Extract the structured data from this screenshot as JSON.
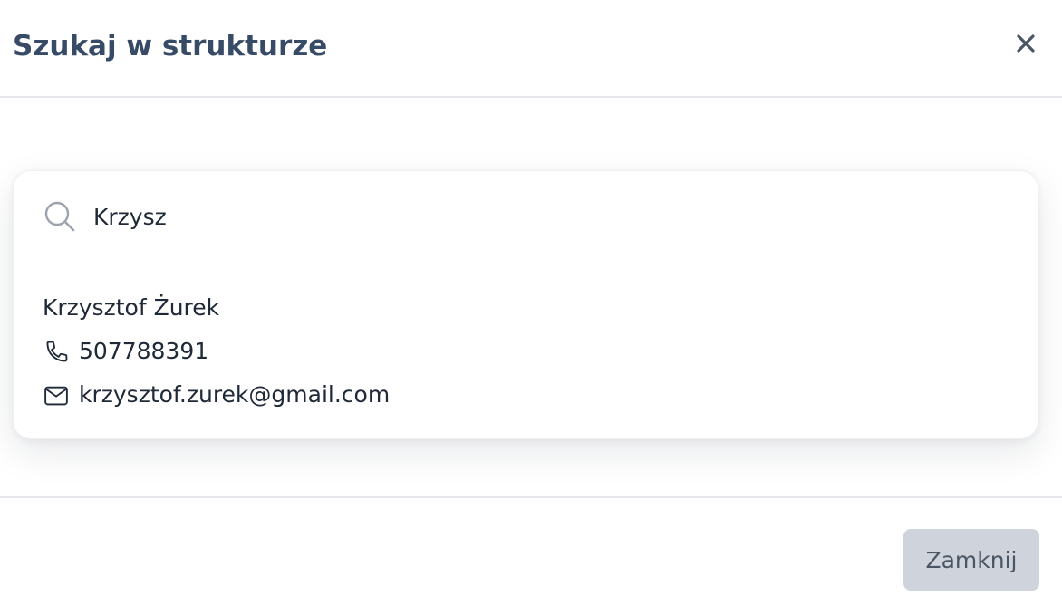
{
  "modal": {
    "title": "Szukaj w strukturze",
    "close_icon": "close-icon"
  },
  "search": {
    "value": "Krzysz",
    "icon": "search-icon"
  },
  "results": [
    {
      "name": "Krzysztof Żurek",
      "phone": "507788391",
      "email": "krzysztof.zurek@gmail.com",
      "phone_icon": "phone-icon",
      "email_icon": "mail-icon"
    }
  ],
  "footer": {
    "close_label": "Zamknij"
  },
  "colors": {
    "title": "#374a66",
    "text": "#1f2937",
    "icon_muted": "#9ca3af",
    "button_bg": "#cfd4dc",
    "button_text": "#4b5563",
    "divider": "#e5e7eb"
  }
}
